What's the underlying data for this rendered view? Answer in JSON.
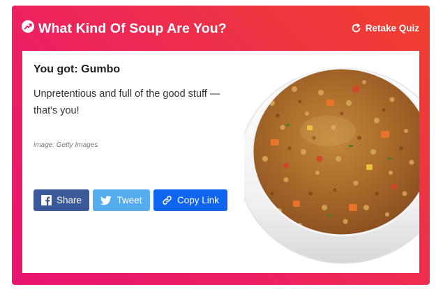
{
  "header": {
    "title": "What Kind Of Soup Are You?",
    "retake_label": "Retake Quiz",
    "icons": {
      "trend": "trending-arrow-icon",
      "retake": "refresh-icon"
    }
  },
  "result": {
    "title": "You got: Gumbo",
    "description": "Unpretentious and full of the good stuff — that's you!",
    "image_credit": "image: Getty Images",
    "image_alt": "Bowl of gumbo soup"
  },
  "share": {
    "facebook_label": "Share",
    "twitter_label": "Tweet",
    "copy_label": "Copy Link"
  },
  "colors": {
    "gradient_start": "#e8156f",
    "gradient_end": "#f0402f",
    "facebook": "#3b5998",
    "twitter": "#55acee",
    "copy_link": "#0f65ef"
  }
}
